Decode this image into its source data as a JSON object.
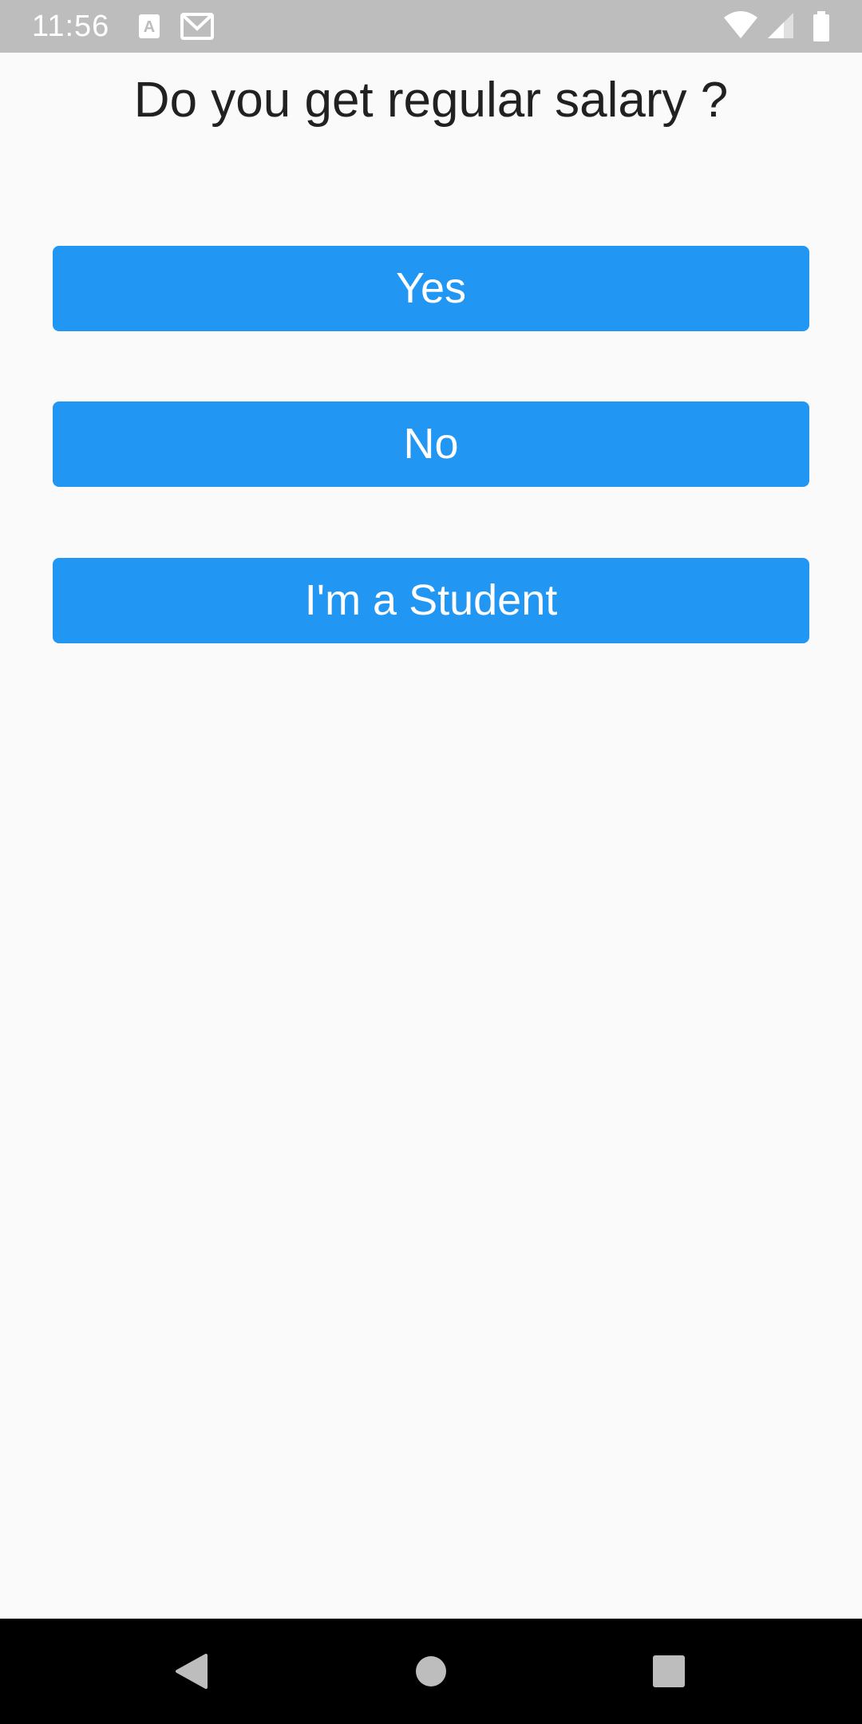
{
  "status_bar": {
    "time": "11:56",
    "notification_icons": [
      "text-a-icon",
      "gmail-icon"
    ],
    "system_icons": [
      "wifi-icon",
      "cellular-signal-icon",
      "battery-icon"
    ],
    "background_color": "#bdbdbd"
  },
  "question": {
    "text": "Do you get regular salary ?"
  },
  "answers": [
    {
      "label": "Yes"
    },
    {
      "label": "No"
    },
    {
      "label": "I'm a Student"
    }
  ],
  "theme": {
    "button_color": "#2196f3",
    "button_text_color": "#ffffff",
    "background": "#fafafa",
    "text_color": "#212121"
  },
  "navigation_bar": {
    "buttons": [
      "back-icon",
      "home-icon",
      "recents-icon"
    ]
  }
}
